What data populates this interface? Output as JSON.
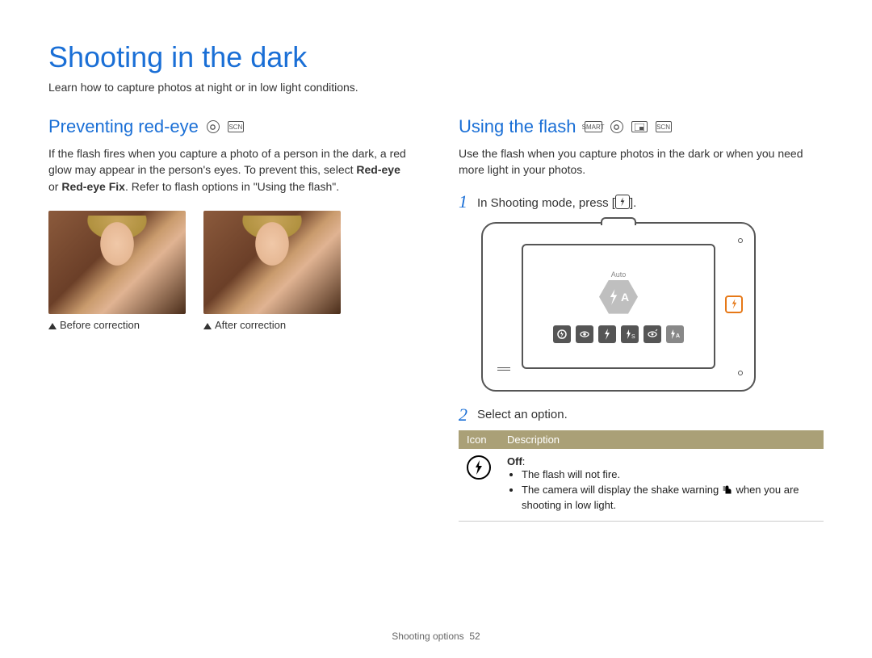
{
  "page": {
    "title": "Shooting in the dark",
    "subtitle": "Learn how to capture photos at night or in low light conditions.",
    "footer_section": "Shooting options",
    "footer_page": "52"
  },
  "left": {
    "heading": "Preventing red-eye",
    "mode_icons": [
      "program-mode-icon",
      "scene-mode-icon"
    ],
    "body_parts": {
      "p1": "If the flash fires when you capture a photo of a person in the dark, a red glow may appear in the person's eyes. To prevent this, select ",
      "b1": "Red-eye",
      "p2": " or ",
      "b2": "Red-eye Fix",
      "p3": ". Refer to flash options in \"Using the flash\"."
    },
    "captions": {
      "before": "Before correction",
      "after": "After correction"
    }
  },
  "right": {
    "heading": "Using the flash",
    "mode_icons": [
      "smart-auto-mode-icon",
      "program-mode-icon",
      "picture-in-picture-mode-icon",
      "scene-mode-icon"
    ],
    "body": "Use the flash when you capture photos in the dark or when you need more light in your photos.",
    "steps": {
      "s1": {
        "num": "1",
        "text_a": "In Shooting mode, press [",
        "text_b": "]."
      },
      "s2": {
        "num": "2",
        "text": "Select an option."
      }
    },
    "camera": {
      "flash_mode_label": "Auto",
      "option_icons": [
        "flash-off-icon",
        "redeye-icon",
        "flash-fill-icon",
        "flash-slow-icon",
        "redeye-fix-icon",
        "flash-auto-icon"
      ]
    },
    "table": {
      "h_icon": "Icon",
      "h_desc": "Description",
      "rows": [
        {
          "icon_name": "flash-off-icon",
          "label": "Off",
          "bullets": [
            "The flash will not fire.",
            "The camera will display the shake warning   when you are shooting in low light."
          ]
        }
      ]
    }
  }
}
